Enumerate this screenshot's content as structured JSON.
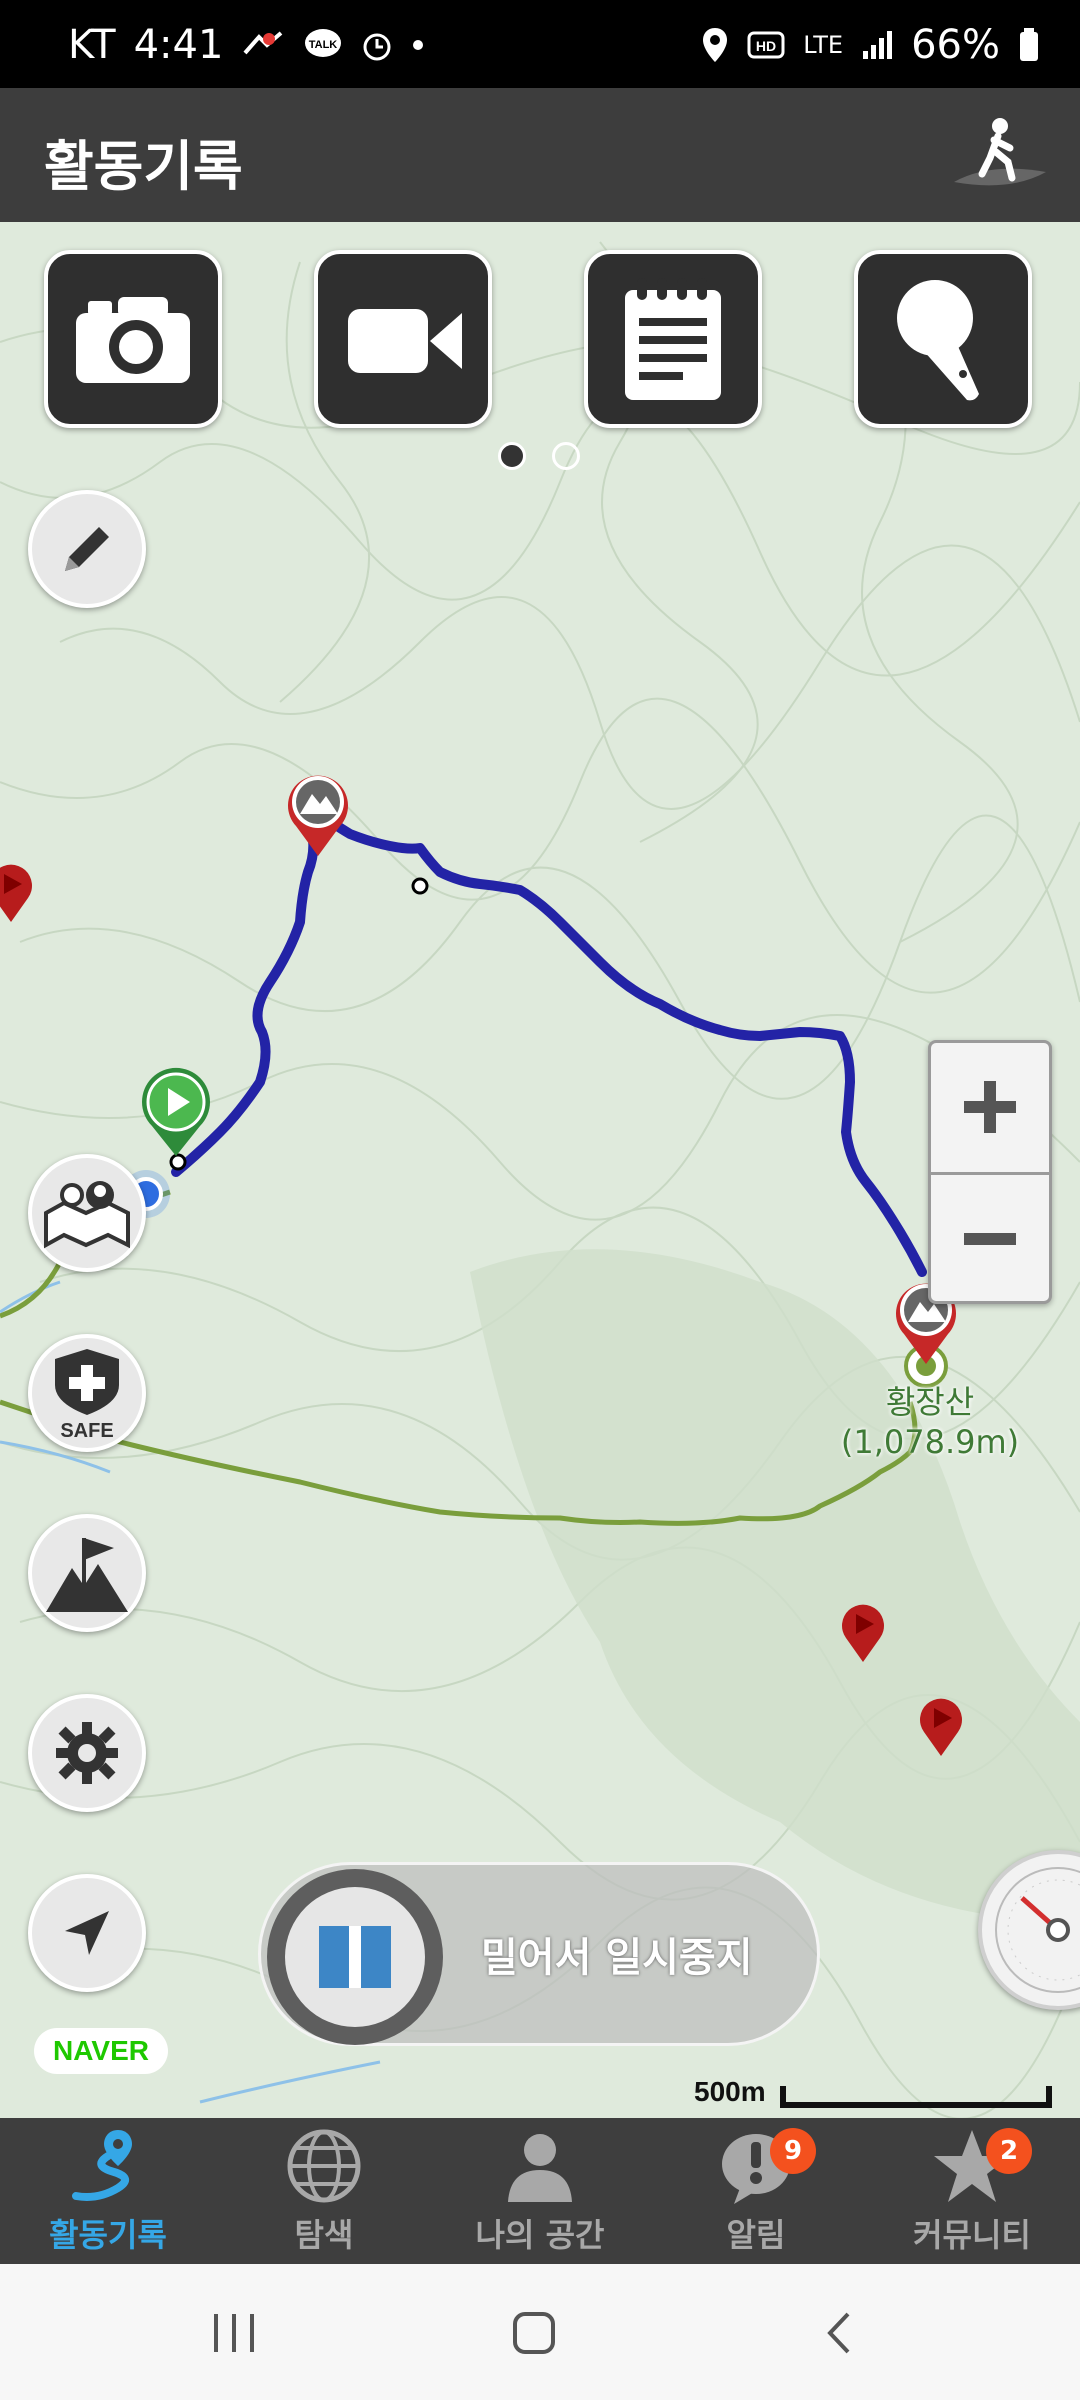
{
  "status_bar": {
    "carrier": "KT",
    "time": "4:41",
    "network": "LTE",
    "hd": "HD",
    "battery": "66%",
    "icons_left": [
      "hiking-notification-icon",
      "kakaotalk-icon",
      "alarm-icon",
      "dot-icon"
    ],
    "icons_right": [
      "location-icon",
      "hd-voice-icon",
      "lte-icon",
      "signal-icon",
      "battery-icon"
    ]
  },
  "header": {
    "title": "활동기록",
    "action_icon": "hiker-icon"
  },
  "quick_actions": [
    {
      "id": "camera",
      "icon": "camera-icon"
    },
    {
      "id": "video",
      "icon": "video-icon"
    },
    {
      "id": "memo",
      "icon": "memo-icon"
    },
    {
      "id": "voice",
      "icon": "microphone-icon"
    }
  ],
  "pager": {
    "pages": 2,
    "active": 1
  },
  "side_buttons": [
    "pencil-icon",
    "group-map-icon",
    "safe-shield-icon",
    "mountain-flag-icon",
    "gear-icon",
    "navigate-arrow-icon"
  ],
  "safe_label": "SAFE",
  "map": {
    "peak_name": "황장산",
    "peak_elevation": "(1,078.9m)",
    "route_color": "#2323a6",
    "trail_color": "#7a9e3c",
    "start_marker_color": "#3db34a",
    "peak_marker_color": "#c62828"
  },
  "zoom": {
    "in": "+",
    "out": "−"
  },
  "pause_slider": {
    "label": "밀어서 일시중지",
    "accent": "#3d86c6"
  },
  "provider": "NAVER",
  "scale": {
    "label": "500m"
  },
  "bottom_nav": [
    {
      "label": "활동기록",
      "icon": "route-icon",
      "active": true,
      "badge": ""
    },
    {
      "label": "탐색",
      "icon": "globe-icon",
      "active": false,
      "badge": ""
    },
    {
      "label": "나의 공간",
      "icon": "person-icon",
      "active": false,
      "badge": ""
    },
    {
      "label": "알림",
      "icon": "bell-alert-icon",
      "active": false,
      "badge": "9"
    },
    {
      "label": "커뮤니티",
      "icon": "star-icon",
      "active": false,
      "badge": "2"
    }
  ],
  "system_nav": [
    "recents-icon",
    "home-icon",
    "back-icon"
  ]
}
